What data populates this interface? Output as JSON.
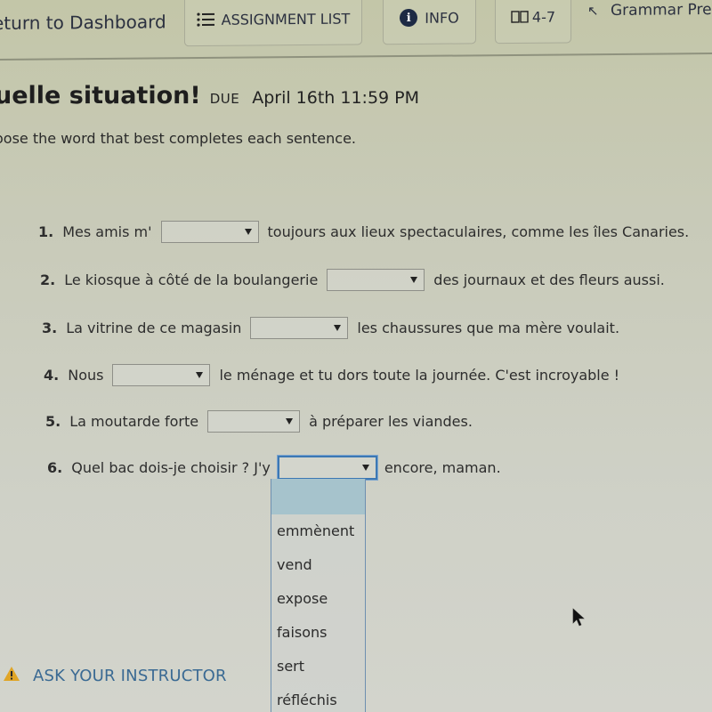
{
  "topbar": {
    "return_link": "eturn to Dashboard",
    "assignment_list": "ASSIGNMENT LIST",
    "info": "INFO",
    "book_section": "4-7",
    "grammar_link": "Grammar Pres",
    "icons": {
      "assignment_list": "list-icon",
      "info": "info-circle-icon",
      "book": "book-icon",
      "grammar": "arrow-up-left-icon"
    }
  },
  "assignment": {
    "title": "uelle situation!",
    "due_label": "DUE",
    "due_date": "April 16th 11:59 PM",
    "instructions": "oose the word that best completes each sentence."
  },
  "questions": [
    {
      "num": "1.",
      "before": "Mes amis m'",
      "after": "toujours aux lieux spectaculaires, comme les îles Canaries.",
      "value": ""
    },
    {
      "num": "2.",
      "before": "Le kiosque à côté de la boulangerie",
      "after": "des journaux et des fleurs aussi.",
      "value": ""
    },
    {
      "num": "3.",
      "before": "La vitrine de ce magasin",
      "after": "les chaussures que ma mère voulait.",
      "value": ""
    },
    {
      "num": "4.",
      "before": "Nous",
      "after": "le ménage et tu dors toute la journée. C'est incroyable !",
      "value": ""
    },
    {
      "num": "5.",
      "before": "La moutarde forte",
      "after": "à préparer les viandes.",
      "value": ""
    },
    {
      "num": "6.",
      "before": "Quel bac dois-je choisir ? J'y",
      "after": "encore, maman.",
      "value": ""
    }
  ],
  "dropdown": {
    "open_for_question": 6,
    "highlighted": "",
    "options": [
      "emmènent",
      "vend",
      "expose",
      "faisons",
      "sert",
      "réfléchis"
    ]
  },
  "footer": {
    "ask_instructor": "ASK YOUR INSTRUCTOR",
    "warning_icon": "warning-triangle-icon"
  },
  "colors": {
    "accent_link": "#3a6a93",
    "focus_border": "#3c78b4",
    "highlight_option": "#a6c3cc",
    "warning": "#e0a526"
  }
}
